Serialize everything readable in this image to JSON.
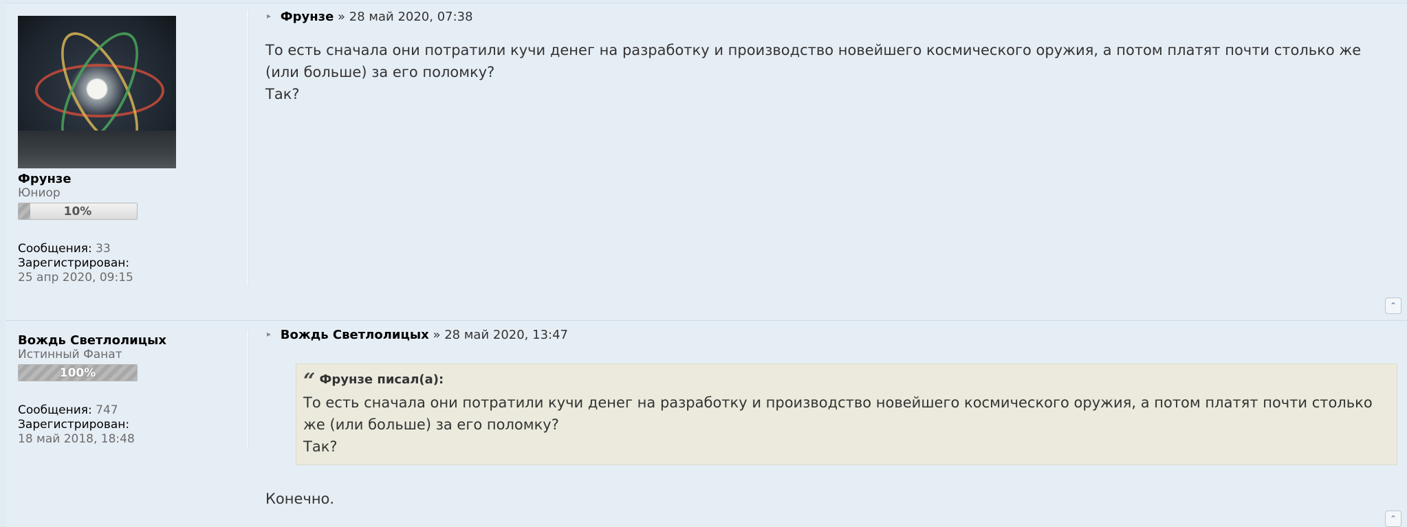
{
  "posts": [
    {
      "author": "Фрунзе",
      "rank": "Юниор",
      "rank_progress_label": "10%",
      "rank_progress": 0.1,
      "stats_messages_label": "Сообщения:",
      "stats_messages": "33",
      "registered_label": "Зарегистрирован:",
      "registered": "25 апр 2020, 09:15",
      "header_separator": "»",
      "date": "28 май 2020, 07:38",
      "body_lines": [
        "То есть сначала они потратили кучи денег на разработку и производство новейшего космического оружия, а потом платят почти столько же (или больше) за его поломку?",
        "Так?"
      ],
      "has_avatar": true
    },
    {
      "author": "Вождь Светлолицых",
      "rank": "Истинный Фанат",
      "rank_progress_label": "100%",
      "rank_progress": 1.0,
      "stats_messages_label": "Сообщения:",
      "stats_messages": "747",
      "registered_label": "Зарегистрирован:",
      "registered": "18 май 2018, 18:48",
      "header_separator": "»",
      "date": "28 май 2020, 13:47",
      "quote": {
        "header": "Фрунзе писал(а):",
        "lines": [
          "То есть сначала они потратили кучи денег на разработку и производство новейшего космического оружия, а потом платят почти столько же (или больше) за его поломку?",
          "Так?"
        ]
      },
      "body_lines": [
        "Конечно."
      ],
      "has_avatar": false
    }
  ],
  "icons": {
    "post_arrow": "post-arrow-icon",
    "back_to_top": "back-to-top-icon",
    "quote_mark": "quote-mark-icon"
  }
}
